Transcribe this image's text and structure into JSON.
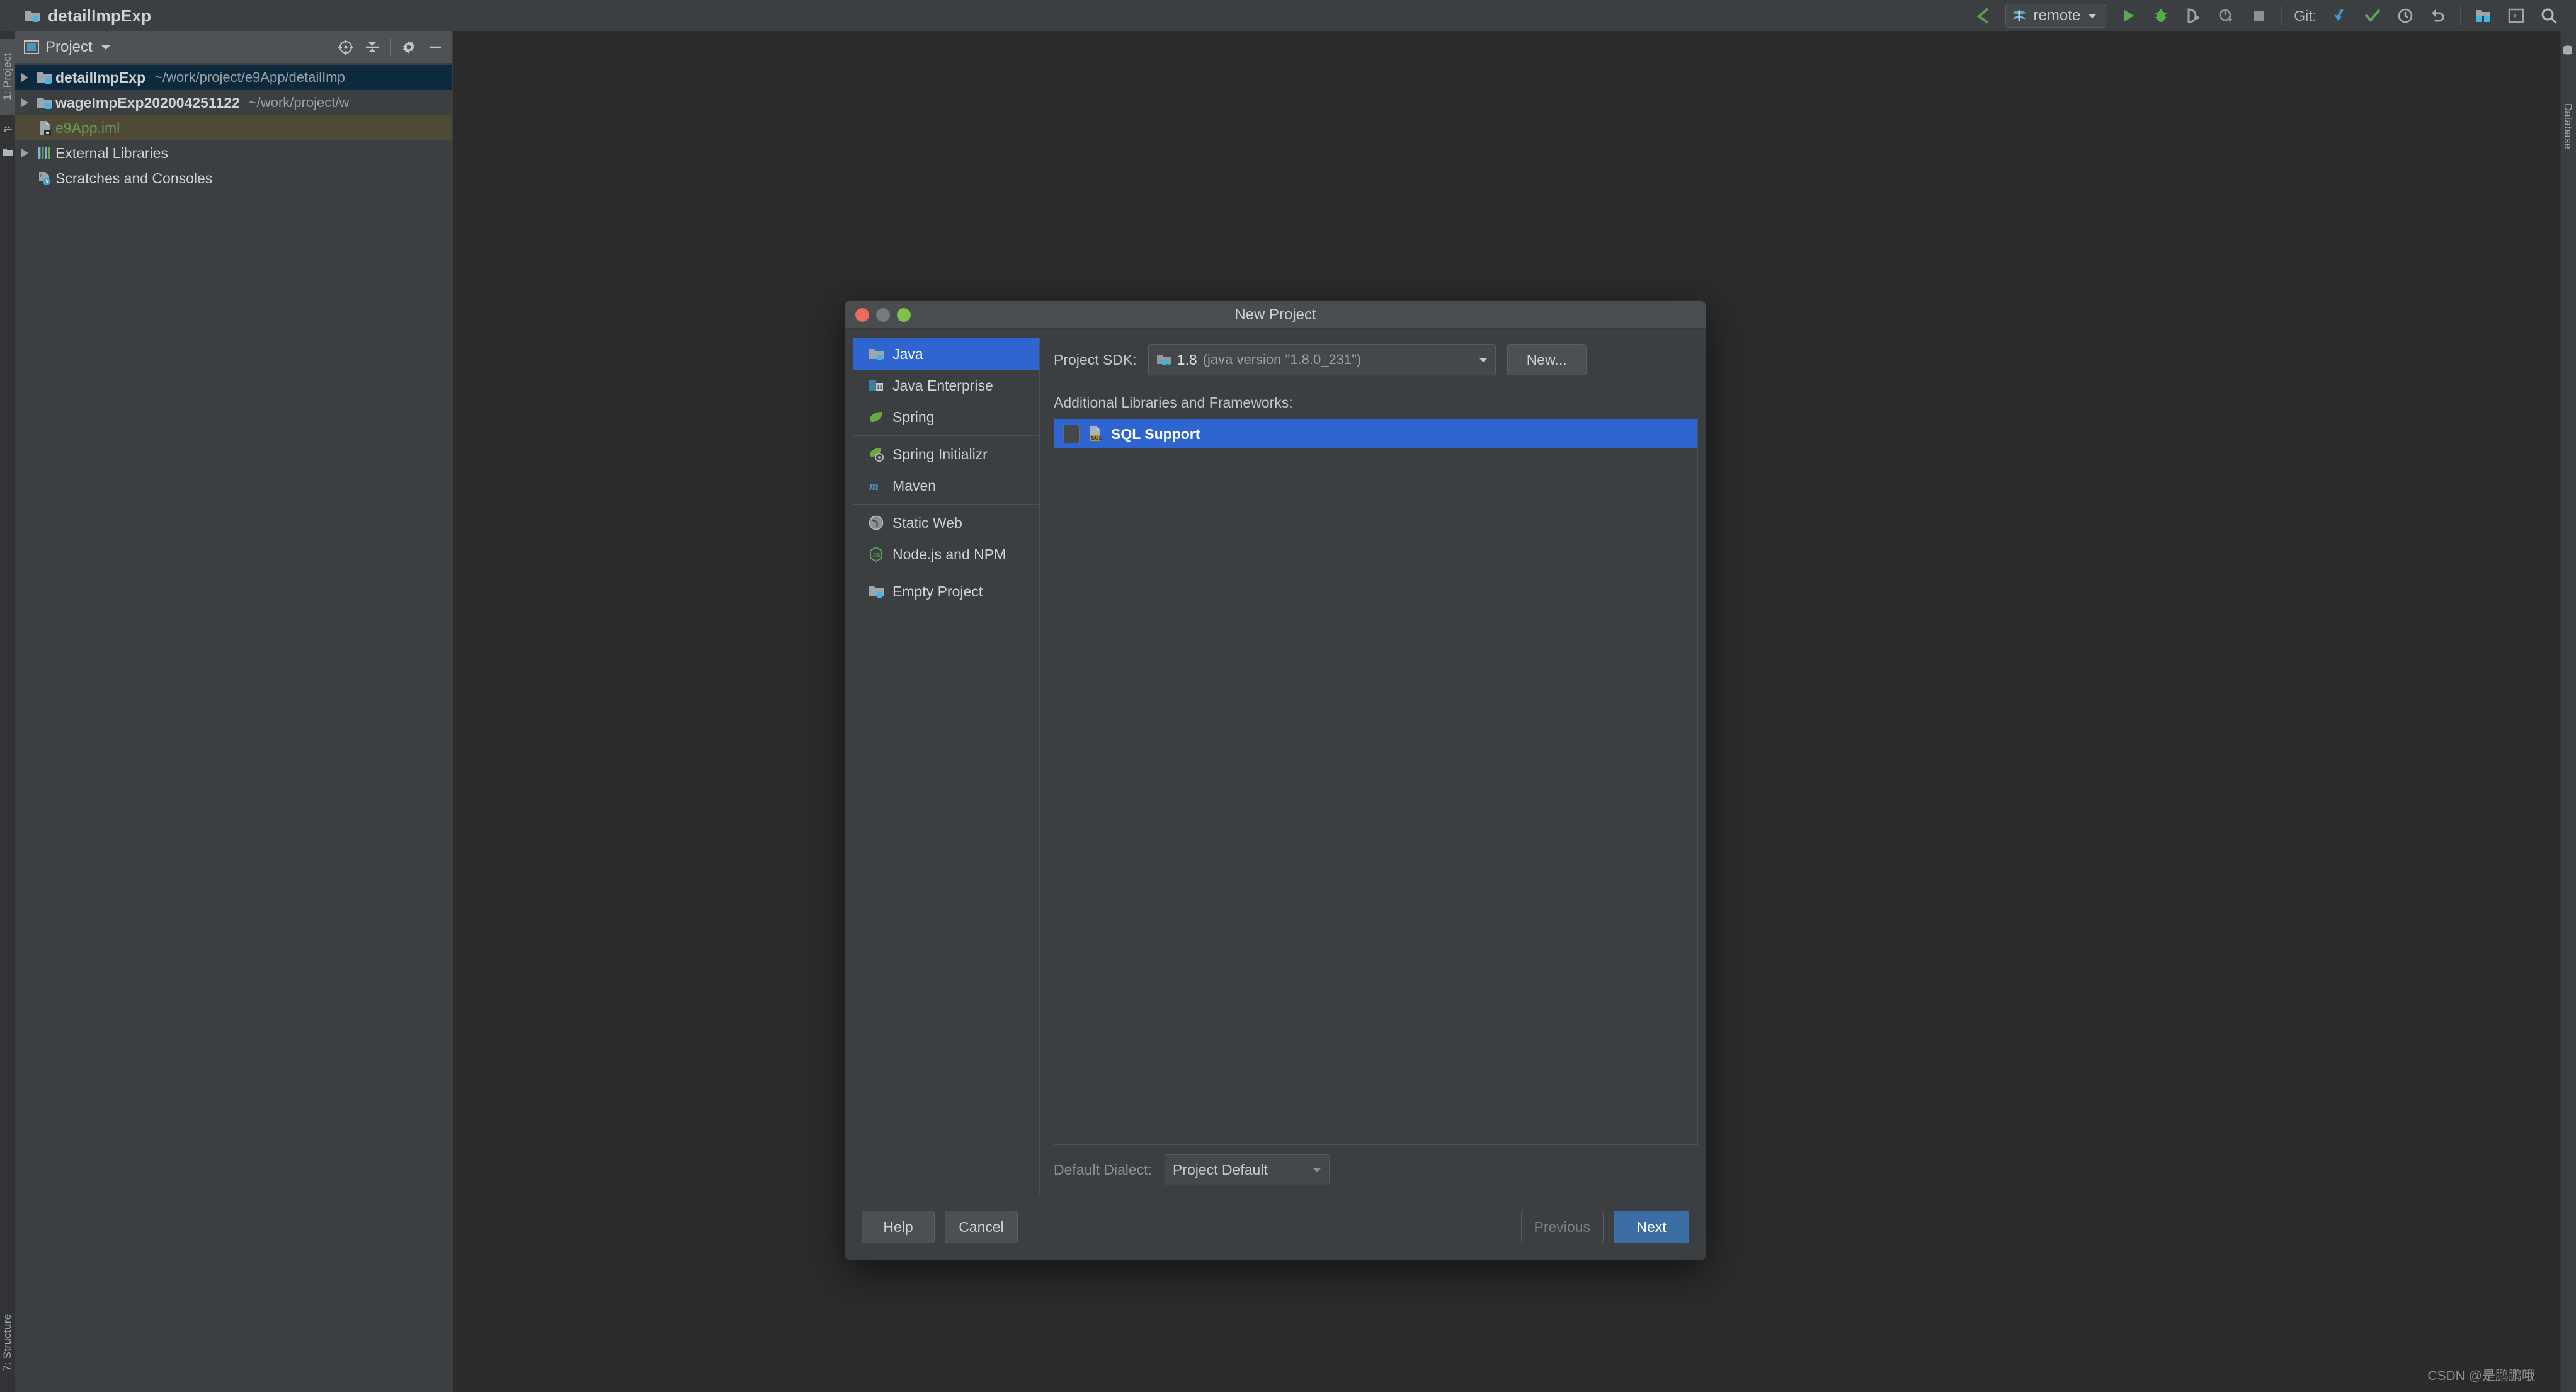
{
  "titlebar": {
    "project_name": "detailImpExp",
    "run_config": "remote",
    "git_label": "Git:",
    "icons": {
      "back": "back-arrow-icon",
      "run": "run-icon",
      "debug": "debug-icon",
      "coverage": "run-with-coverage-icon",
      "profiler": "profiler-icon",
      "stop": "stop-icon",
      "git_update": "git-update-icon",
      "git_commit": "git-commit-icon",
      "git_history": "git-history-icon",
      "git_rollback": "git-rollback-icon",
      "project_structure": "project-structure-icon",
      "terminal": "terminal-icon",
      "search": "search-everywhere-icon"
    }
  },
  "left_strip": {
    "project_tab": "1: Project",
    "structure_tab": "7: Structure"
  },
  "right_strip": {
    "database_tab": "Database"
  },
  "project_panel": {
    "title": "Project",
    "actions": {
      "locate": "Select Opened File",
      "collapse": "Collapse All",
      "settings": "Settings",
      "hide": "Hide"
    },
    "tree": [
      {
        "name": "detailImpExp",
        "path": "~/work/project/e9App/detailImp",
        "icon": "module-folder-icon",
        "expandable": true,
        "state": "selected",
        "indent": 0
      },
      {
        "name": "wageImpExp202004251122",
        "path": "~/work/project/w",
        "icon": "module-folder-icon",
        "expandable": true,
        "state": "none",
        "indent": 0
      },
      {
        "name": "e9App.iml",
        "path": "",
        "icon": "iml-file-icon",
        "expandable": false,
        "state": "highlighted",
        "indent": 1
      },
      {
        "name": "External Libraries",
        "path": "",
        "icon": "libraries-icon",
        "expandable": true,
        "state": "none",
        "indent": 0
      },
      {
        "name": "Scratches and Consoles",
        "path": "",
        "icon": "scratches-icon",
        "expandable": false,
        "state": "none",
        "indent": 0
      }
    ]
  },
  "watermark": "CSDN @是鹏鹏哦",
  "dialog": {
    "title": "New Project",
    "window_controls": {
      "close": "close-button",
      "minimize": "minimize-button",
      "zoom": "zoom-button"
    },
    "categories": [
      {
        "label": "Java",
        "icon": "java-module-icon",
        "selected": true
      },
      {
        "label": "Java Enterprise",
        "icon": "java-enterprise-icon",
        "selected": false
      },
      {
        "label": "Spring",
        "icon": "spring-leaf-icon",
        "selected": false
      },
      {
        "label": "Spring Initializr",
        "icon": "spring-initializr-icon",
        "selected": false
      },
      {
        "label": "Maven",
        "icon": "maven-icon",
        "selected": false
      },
      {
        "label": "Static Web",
        "icon": "static-web-icon",
        "selected": false
      },
      {
        "label": "Node.js and NPM",
        "icon": "nodejs-icon",
        "selected": false
      },
      {
        "label": "Empty Project",
        "icon": "empty-project-icon",
        "selected": false
      }
    ],
    "sdk": {
      "label": "Project SDK:",
      "value": "1.8",
      "detail": "(java version \"1.8.0_231\")",
      "new_button": "New..."
    },
    "frameworks": {
      "label": "Additional Libraries and Frameworks:",
      "items": [
        {
          "label": "SQL Support",
          "checked": false,
          "selected": true,
          "icon": "sql-support-icon"
        }
      ]
    },
    "dialect": {
      "label": "Default Dialect:",
      "value": "Project Default"
    },
    "footer": {
      "help": "Help",
      "cancel": "Cancel",
      "previous": "Previous",
      "next": "Next"
    }
  }
}
